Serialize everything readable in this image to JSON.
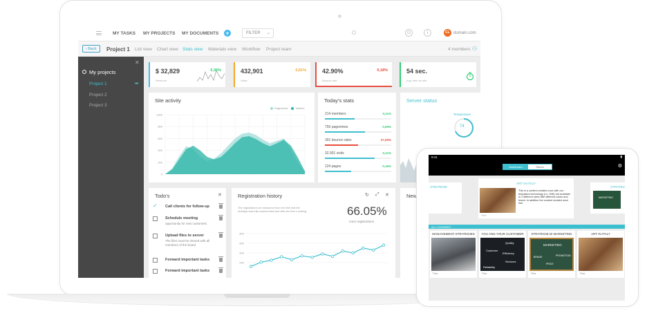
{
  "topbar": {
    "nav": [
      "MY TASKS",
      "MY PROJECTS",
      "MY DOCUMENTS"
    ],
    "filter": "FILTER",
    "avatar": "CL",
    "domain": "domain.com"
  },
  "subbar": {
    "back": "Back",
    "project": "Project 1",
    "views": [
      "List view",
      "Chart view",
      "Stats view",
      "Materials view",
      "Workflow",
      "Project team"
    ],
    "active_view": "Stats view",
    "members": "4 members"
  },
  "sidebar": {
    "title": "My projects",
    "items": [
      "Project 1",
      "Project 2",
      "Project 3"
    ],
    "active": "Project 1"
  },
  "kpis": [
    {
      "value": "$ 32,829",
      "label": "Revenue",
      "pct": "0,36%",
      "color": "#44b8ec",
      "trend": "up"
    },
    {
      "value": "432,901",
      "label": "Visits",
      "pct": "0,61%",
      "color": "#f5a623",
      "trend": "down"
    },
    {
      "value": "42.90%",
      "label": "Bounce rate",
      "pct": "0,18%",
      "color": "#e84c3d",
      "trend": "down"
    },
    {
      "value": "54 sec.",
      "label": "Avg. time on site",
      "pct": "",
      "color": "#2ecc71",
      "trend": ""
    }
  ],
  "site_activity": {
    "title": "Site activity",
    "legend": [
      "Pageviews",
      "Visitors"
    ],
    "yticks": [
      "1000",
      "800",
      "600",
      "400",
      "200",
      "0"
    ]
  },
  "chart_data": {
    "type": "area",
    "x": [
      0,
      1,
      2,
      3,
      4,
      5,
      6,
      7,
      8,
      9,
      10,
      11,
      12,
      13,
      14,
      15,
      16,
      17,
      18,
      19,
      20
    ],
    "series": [
      {
        "name": "Pageviews",
        "values": [
          0,
          100,
          300,
          470,
          420,
          300,
          220,
          260,
          350,
          480,
          600,
          680,
          700,
          660,
          580,
          520,
          560,
          600,
          420,
          200,
          40
        ],
        "color": "#9fdcd8"
      },
      {
        "name": "Visitors",
        "values": [
          0,
          80,
          250,
          420,
          480,
          400,
          290,
          250,
          290,
          400,
          520,
          620,
          640,
          590,
          520,
          470,
          520,
          580,
          480,
          280,
          50
        ],
        "color": "#2ab3a6"
      }
    ],
    "ylim": [
      0,
      1000
    ],
    "yticks": [
      0,
      200,
      400,
      600,
      800,
      1000
    ]
  },
  "todays_stats": {
    "title": "Today's stats",
    "rows": [
      {
        "num": "214 members",
        "pct": "0,11%",
        "color": "#2ecc71",
        "bar": "#3ebfcf",
        "fill": 0.45
      },
      {
        "num": "756 pageviews",
        "pct": "0,05%",
        "color": "#2ecc71",
        "bar": "#3ebfcf",
        "fill": 0.6
      },
      {
        "num": "391 bounce rates",
        "pct": "27,05%",
        "color": "#e84c3d",
        "bar": "#e84c3d",
        "fill": 0.5
      },
      {
        "num": "32,901 visits",
        "pct": "0,11%",
        "color": "#2ecc71",
        "bar": "#3ebfcf",
        "fill": 0.75
      },
      {
        "num": "124 pages",
        "pct": "0,15%",
        "color": "#2ecc71",
        "bar": "#3ebfcf",
        "fill": 0.4
      }
    ]
  },
  "server_status": {
    "title": "Server status",
    "temp_label": "Temperature",
    "temp": "74"
  },
  "todos": {
    "title": "Todo's",
    "items": [
      {
        "title": "Call clients for follow-up",
        "sub": "",
        "checked": true
      },
      {
        "title": "Schedule meeting",
        "sub": "opportunity for new customers",
        "checked": false
      },
      {
        "title": "Upload files to server",
        "sub": "The files must be shared with all members of the board",
        "checked": false
      },
      {
        "title": "Forward important tasks",
        "sub": "",
        "checked": false
      },
      {
        "title": "Forward important tasks",
        "sub": "",
        "checked": false
      }
    ]
  },
  "registration": {
    "title": "Registration history",
    "note": "The registrations are measured from the time that the redesign was fully implemented and after the first e-mailing.",
    "big": "66.05%",
    "sub": "more registrations",
    "yticks": [
      "800",
      "600",
      "400",
      "200"
    ],
    "points": [
      120,
      210,
      250,
      320,
      260,
      340,
      310,
      380,
      330,
      440,
      400,
      500,
      460,
      560
    ]
  },
  "news_title": "New",
  "tablet": {
    "time": "9:41",
    "tabs": [
      "Dashboard",
      "Stores"
    ],
    "card1_head": "STRATEGIE",
    "card2_head": "ART IN ITALY",
    "card2_text": "This is a content created once with our templates technology (i.e. HMI) but available in 2 different sizes with different colors and brand. In addition the content created once has",
    "card3_head": "STRATEG",
    "section": "ALL COURSES",
    "courses": [
      "MANAGEMENT STRATEGIES",
      "YOU AND YOUR CUSTOMER",
      "STRATEGIE DI MARKETING",
      "ART IN ITALY"
    ],
    "foot": "Files",
    "chalk_words": [
      "Quality",
      "Customer",
      "Efficiency",
      "Services",
      "Reliability"
    ],
    "marketing": "MARKETING",
    "marketing_sub": [
      "BRAND",
      "PRICE",
      "PROMOTION"
    ],
    "marketing_small": "MARKETING"
  }
}
